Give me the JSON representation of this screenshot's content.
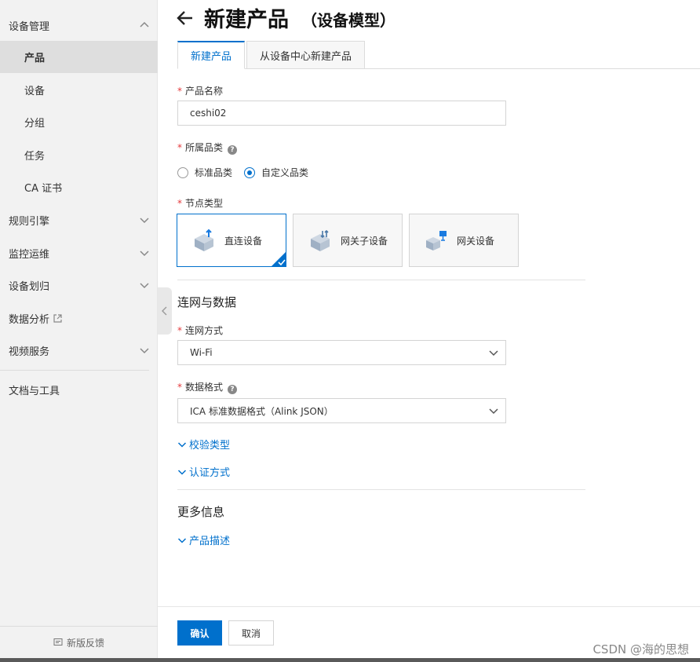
{
  "sidebar": {
    "section_device_mgmt": "设备管理",
    "sub_items": [
      "产品",
      "设备",
      "分组",
      "任务",
      "CA 证书"
    ],
    "active_sub": "产品",
    "groups": [
      "规则引擎",
      "监控运维",
      "设备划归",
      "数据分析",
      "视频服务"
    ],
    "docs": "文档与工具",
    "feedback": "新版反馈"
  },
  "header": {
    "title": "新建产品",
    "subtitle": "（设备模型）"
  },
  "tabs": [
    {
      "label": "新建产品",
      "active": true
    },
    {
      "label": "从设备中心新建产品",
      "active": false
    }
  ],
  "form": {
    "required_mark": "*",
    "product_name": {
      "label": "产品名称",
      "value": "ceshi02"
    },
    "category": {
      "label": "所属品类",
      "help": "?",
      "options": [
        {
          "label": "标准品类",
          "checked": false
        },
        {
          "label": "自定义品类",
          "checked": true
        }
      ]
    },
    "node_type": {
      "label": "节点类型",
      "options": [
        {
          "label": "直连设备",
          "active": true
        },
        {
          "label": "网关子设备",
          "active": false
        },
        {
          "label": "网关设备",
          "active": false
        }
      ]
    },
    "network_section": "连网与数据",
    "network_method": {
      "label": "连网方式",
      "value": "Wi-Fi"
    },
    "data_format": {
      "label": "数据格式",
      "help": "?",
      "value": "ICA 标准数据格式（Alink JSON）"
    },
    "check_type": "校验类型",
    "auth_method": "认证方式",
    "more_section": "更多信息",
    "product_desc": "产品描述"
  },
  "footer": {
    "confirm": "确认",
    "cancel": "取消"
  },
  "watermark": "CSDN @海的思想",
  "colors": {
    "accent": "#0070cc",
    "required": "#e4393c"
  }
}
